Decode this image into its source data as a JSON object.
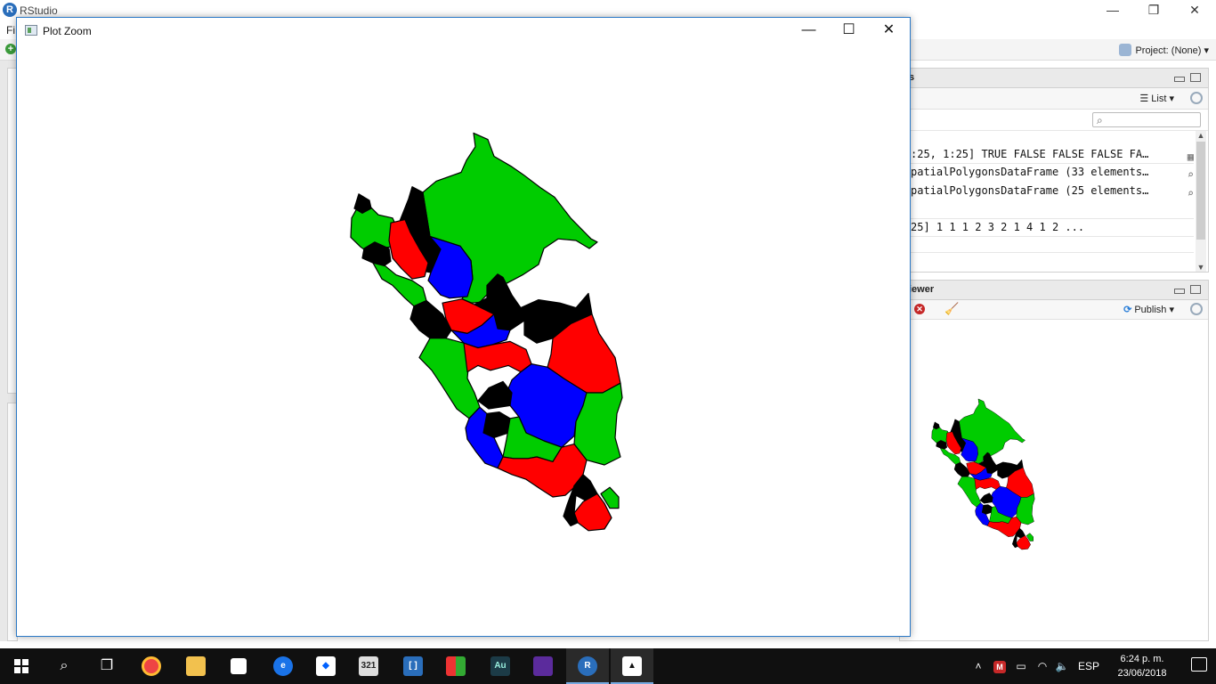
{
  "rstudio": {
    "title": "RStudio",
    "menu_first": "Fi",
    "project_label": "Project: (None)",
    "env_tab_fragment": "s",
    "list_label": "List",
    "env_rows": [
      ":25, 1:25] TRUE FALSE FALSE FALSE FA…",
      "patialPolygonsDataFrame (33 elements…",
      "patialPolygonsDataFrame (25 elements…",
      "25] 1 1 1 2 3 2 1 4 1 2 ..."
    ],
    "viewer_tab": "iewer",
    "publish_label": "Publish"
  },
  "plot_zoom": {
    "title": "Plot Zoom"
  },
  "map": {
    "palette": [
      "#00cc00",
      "#ff0000",
      "#0000ff",
      "#000000"
    ]
  },
  "taskbar": {
    "language": "ESP",
    "time": "6:24 p. m.",
    "date": "23/06/2018"
  }
}
